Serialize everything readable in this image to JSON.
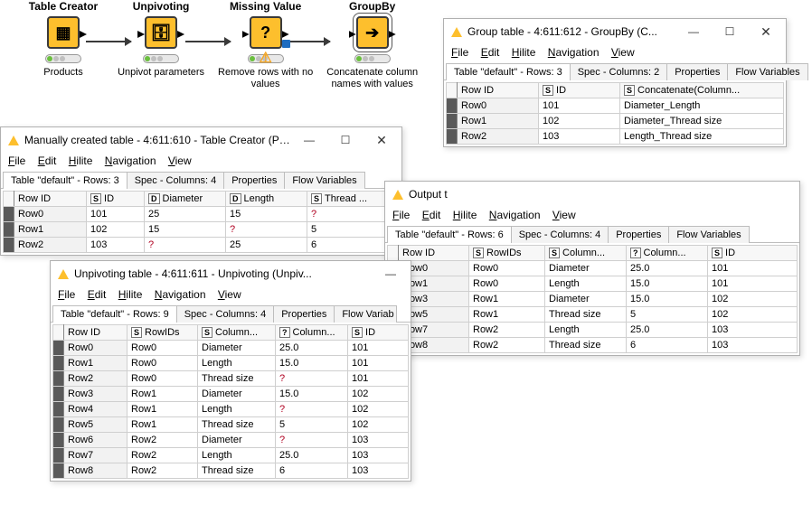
{
  "workflow": {
    "nodes": [
      {
        "title": "Table Creator",
        "caption": "Products",
        "glyph": "▦"
      },
      {
        "title": "Unpivoting",
        "caption": "Unpivot parameters",
        "glyph": "🗄"
      },
      {
        "title": "Missing Value",
        "caption": "Remove rows with no values",
        "glyph": "?",
        "warn": true
      },
      {
        "title": "GroupBy",
        "caption": "Concatenate column names with values",
        "glyph": "➔",
        "selected": true
      }
    ]
  },
  "menus": {
    "file": "File",
    "edit": "Edit",
    "hilite": "Hilite",
    "nav": "Navigation",
    "view": "View"
  },
  "tabs": {
    "spec4": "Spec - Columns: 4",
    "spec2": "Spec - Columns: 2",
    "props": "Properties",
    "flow": "Flow Variables"
  },
  "winbtns": {
    "min": "—",
    "max": "☐",
    "close": "✕"
  },
  "type": {
    "S": "S",
    "D": "D",
    "Q": "?"
  },
  "col_rowid": "Row ID",
  "win_manual": {
    "title": "Manually created table - 4:611:610 - Table Creator (Pr...",
    "tabletab": "Table \"default\" - Rows: 3",
    "cols": {
      "id": "ID",
      "diameter": "Diameter",
      "length": "Length",
      "thread": "Thread ..."
    },
    "rows": [
      {
        "rid": "Row0",
        "id": "101",
        "d": "25",
        "l": "15",
        "t": "?"
      },
      {
        "rid": "Row1",
        "id": "102",
        "d": "15",
        "l": "?",
        "t": "5"
      },
      {
        "rid": "Row2",
        "id": "103",
        "d": "?",
        "l": "25",
        "t": "6"
      }
    ]
  },
  "win_unpivot": {
    "title": "Unpivoting table - 4:611:611 - Unpivoting (Unpiv...",
    "tabletab": "Table \"default\" - Rows: 9",
    "cols": {
      "rowids": "RowIDs",
      "coln": "Column...",
      "colv": "Column...",
      "id": "ID"
    },
    "rows": [
      {
        "rid": "Row0",
        "r": "Row0",
        "c": "Diameter",
        "v": "25.0",
        "id": "101"
      },
      {
        "rid": "Row1",
        "r": "Row0",
        "c": "Length",
        "v": "15.0",
        "id": "101"
      },
      {
        "rid": "Row2",
        "r": "Row0",
        "c": "Thread size",
        "v": "?",
        "id": "101"
      },
      {
        "rid": "Row3",
        "r": "Row1",
        "c": "Diameter",
        "v": "15.0",
        "id": "102"
      },
      {
        "rid": "Row4",
        "r": "Row1",
        "c": "Length",
        "v": "?",
        "id": "102"
      },
      {
        "rid": "Row5",
        "r": "Row1",
        "c": "Thread size",
        "v": "5",
        "id": "102"
      },
      {
        "rid": "Row6",
        "r": "Row2",
        "c": "Diameter",
        "v": "?",
        "id": "103"
      },
      {
        "rid": "Row7",
        "r": "Row2",
        "c": "Length",
        "v": "25.0",
        "id": "103"
      },
      {
        "rid": "Row8",
        "r": "Row2",
        "c": "Thread size",
        "v": "6",
        "id": "103"
      }
    ]
  },
  "win_output": {
    "title": "Output t",
    "tabletab": "Table \"default\" - Rows: 6",
    "cols": {
      "rowids": "RowIDs",
      "coln": "Column...",
      "colv": "Column...",
      "id": "ID"
    },
    "rows": [
      {
        "rid": "Row0",
        "r": "Row0",
        "c": "Diameter",
        "v": "25.0",
        "id": "101"
      },
      {
        "rid": "Row1",
        "r": "Row0",
        "c": "Length",
        "v": "15.0",
        "id": "101"
      },
      {
        "rid": "Row3",
        "r": "Row1",
        "c": "Diameter",
        "v": "15.0",
        "id": "102"
      },
      {
        "rid": "Row5",
        "r": "Row1",
        "c": "Thread size",
        "v": "5",
        "id": "102"
      },
      {
        "rid": "Row7",
        "r": "Row2",
        "c": "Length",
        "v": "25.0",
        "id": "103"
      },
      {
        "rid": "Row8",
        "r": "Row2",
        "c": "Thread size",
        "v": "6",
        "id": "103"
      }
    ]
  },
  "win_group": {
    "title": "Group table - 4:611:612 - GroupBy (C...",
    "tabletab": "Table \"default\" - Rows: 3",
    "cols": {
      "id": "ID",
      "conc": "Concatenate(Column..."
    },
    "rows": [
      {
        "rid": "Row0",
        "id": "101",
        "c": "Diameter_Length"
      },
      {
        "rid": "Row1",
        "id": "102",
        "c": "Diameter_Thread size"
      },
      {
        "rid": "Row2",
        "id": "103",
        "c": "Length_Thread size"
      }
    ]
  }
}
